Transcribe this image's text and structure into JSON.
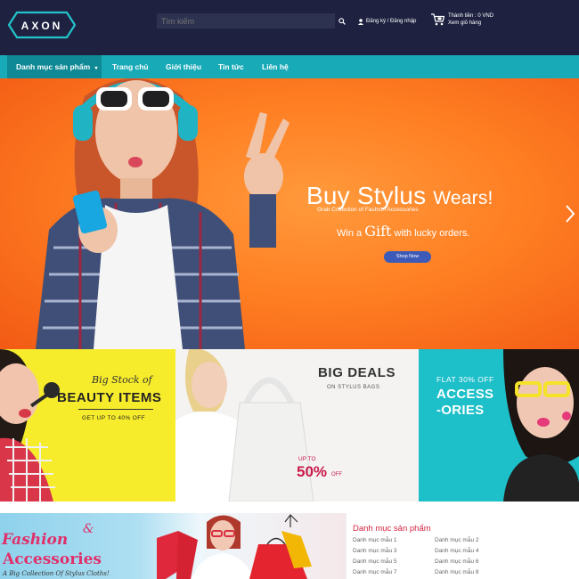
{
  "header": {
    "logo_text": "AXON",
    "search": {
      "placeholder": "Tìm kiếm"
    },
    "account_label": "Đăng ký / Đăng nhập",
    "cart": {
      "total": "Thành tiền : 0 VND",
      "view": "Xem giỏ hàng"
    }
  },
  "nav": {
    "items": [
      {
        "label": "Danh mục sản phẩm",
        "caret": "▾"
      },
      {
        "label": "Trang chủ"
      },
      {
        "label": "Giới thiệu"
      },
      {
        "label": "Tin tức"
      },
      {
        "label": "Liên hệ"
      }
    ]
  },
  "hero": {
    "title_a": "Buy Stylus",
    "title_b": "Wears!",
    "subtitle": "Grab Collection of Fashion Accessories",
    "line_a": "Win a",
    "line_gift": "Gift",
    "line_b": "with lucky orders.",
    "button": "Shop Now"
  },
  "promos": {
    "beauty": {
      "script": "Big Stock of",
      "title": "BEAUTY ITEMS",
      "sub": "GET UP TO 40% OFF"
    },
    "deals": {
      "title": "BIG DEALS",
      "sub": "ON STYLUS BAGS",
      "upto": "UP TO",
      "percent": "50%",
      "off": "OFF"
    },
    "accessories": {
      "sub": "FLAT 30% OFF",
      "title_1": "ACCESS",
      "title_2": "-ORIES"
    }
  },
  "bottom_banner": {
    "line1": "Fashion",
    "amp": "&",
    "line2": "Accessories",
    "line3": "A Big Collection Of Stylus Cloths!"
  },
  "category_panel": {
    "title": "Danh mục sản phẩm",
    "links": [
      "Danh mục mẫu 1",
      "Danh mục mẫu 2",
      "Danh mục mẫu 3",
      "Danh mục mẫu 4",
      "Danh mục mẫu 5",
      "Danh mục mẫu 6",
      "Danh mục mẫu 7",
      "Danh mục mẫu 8"
    ]
  },
  "colors": {
    "header_bg": "#1e2240",
    "nav_bg": "#19aab8",
    "accent_teal": "#19aab8",
    "hero_orange": "#ff7f23",
    "beauty_yellow": "#f7ec2c",
    "accessories_teal": "#1dbfc9",
    "sale_pink": "#c9184a",
    "category_red": "#d1243f"
  },
  "icons": [
    "axon-logo",
    "search-icon",
    "user-icon",
    "cart-icon",
    "chevron-right-icon",
    "caret-down-icon"
  ]
}
